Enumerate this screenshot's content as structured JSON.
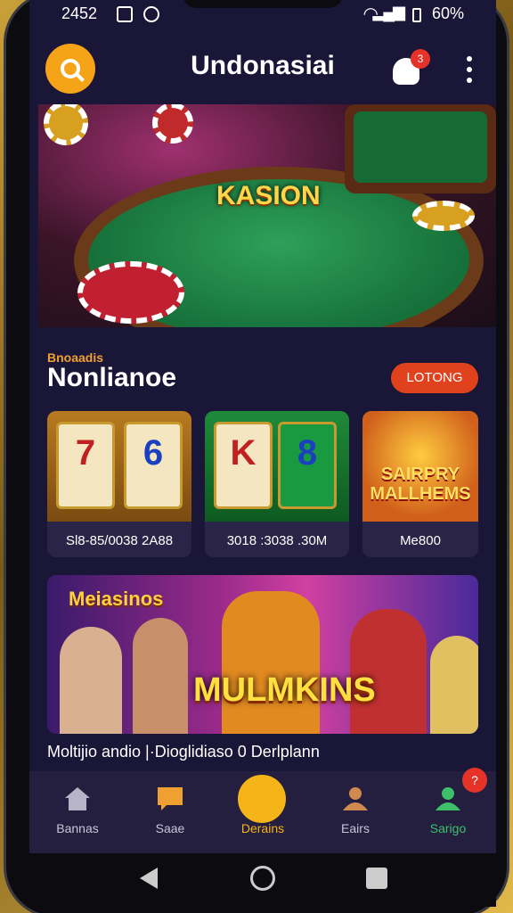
{
  "status_bar": {
    "time": "2452",
    "battery": "60%"
  },
  "header": {
    "title": "Undonasiai",
    "notification_count": "3"
  },
  "hero": {
    "logo_text": "KASION"
  },
  "section": {
    "subtitle": "Bnoaadis",
    "title": "Nonlianoe",
    "cta_label": "LOTONG"
  },
  "games": [
    {
      "label": "Sl8-85/0038 2A88"
    },
    {
      "label": "3018 :3038 .30M"
    },
    {
      "label": "Me800",
      "name": "SAIRPRY MALLHEMS"
    }
  ],
  "promo": {
    "tag": "Meiasinos",
    "title": "MULMKINS",
    "caption": "Moltijio andio |·Dioglidiaso 0 Derlplann"
  },
  "tabbar": {
    "items": [
      {
        "label": "Bannas"
      },
      {
        "label": "Saae"
      },
      {
        "label": "Derains"
      },
      {
        "label": "Eairs"
      },
      {
        "label": "Sarigo",
        "badge": "?"
      }
    ]
  },
  "colors": {
    "accent": "#f5a417",
    "background": "#1a1638",
    "cta": "#e0421e",
    "badge": "#e5332a",
    "active_green": "#3ec06a"
  }
}
